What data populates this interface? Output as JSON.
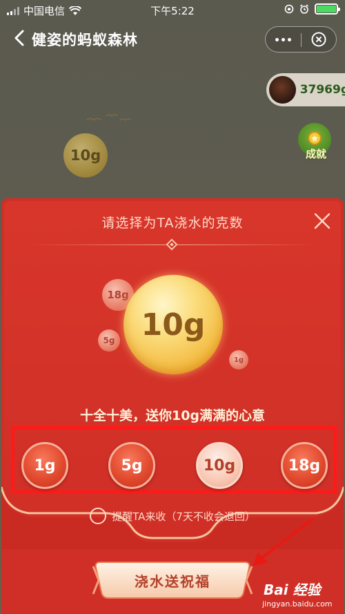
{
  "status_bar": {
    "carrier": "中国电信",
    "time": "下午5:22"
  },
  "nav": {
    "title": "健姿的蚂蚁森林"
  },
  "energy": {
    "value": "37969g"
  },
  "achievement": {
    "label": "成就"
  },
  "background_bubble": {
    "label": "10g"
  },
  "modal": {
    "title": "请选择为TA浇水的克数",
    "main_bubble": "10g",
    "decor_bubbles": [
      "18g",
      "5g",
      "1g"
    ],
    "subtitle": "十全十美，送你10g满满的心意",
    "amounts": [
      {
        "label": "1g",
        "selected": false
      },
      {
        "label": "5g",
        "selected": false
      },
      {
        "label": "10g",
        "selected": true
      },
      {
        "label": "18g",
        "selected": false
      }
    ],
    "remind_text": "提醒TA来收（7天不收会退回）",
    "water_button": "浇水送祝福"
  },
  "watermark": {
    "brand": "Bai 经验",
    "url": "jingyan.baidu.com"
  },
  "colors": {
    "modal_red": "#cf2f26",
    "highlight_box": "#ff1a1a",
    "gold": "#f2b83c"
  }
}
